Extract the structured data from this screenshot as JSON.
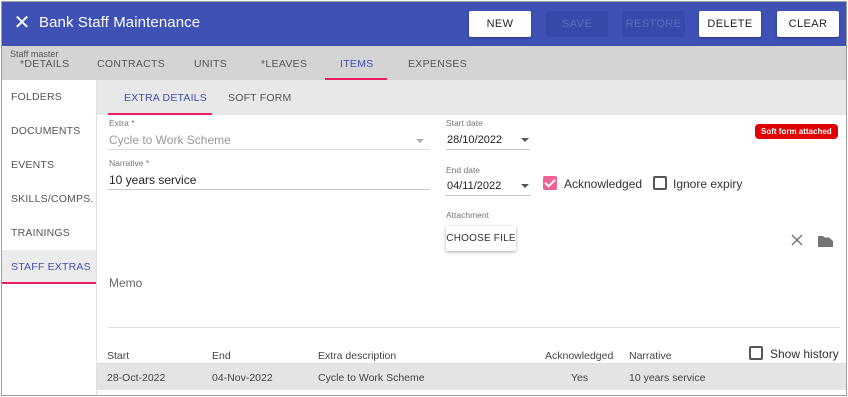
{
  "header": {
    "title": "Bank Staff Maintenance",
    "buttons": {
      "new": "NEW",
      "save": "SAVE",
      "restore": "RESTORE",
      "delete": "DELETE",
      "clear": "CLEAR"
    }
  },
  "tabs": {
    "caption": "Staff master",
    "items": [
      "*DETAILS",
      "CONTRACTS",
      "UNITS",
      "*LEAVES",
      "ITEMS",
      "EXPENSES"
    ],
    "active": "ITEMS"
  },
  "sidebar": {
    "items": [
      "FOLDERS",
      "DOCUMENTS",
      "EVENTS",
      "SKILLS/COMPS.",
      "TRAININGS",
      "STAFF EXTRAS"
    ],
    "active": "STAFF EXTRAS"
  },
  "subtabs": {
    "items": [
      "EXTRA DETAILS",
      "SOFT FORM"
    ],
    "active": "EXTRA DETAILS"
  },
  "form": {
    "extra": {
      "label": "Extra *",
      "value": "Cycle to Work Scheme"
    },
    "narrative": {
      "label": "Narrative *",
      "value": "10 years service"
    },
    "start_date": {
      "label": "Start date",
      "value": "28/10/2022"
    },
    "end_date": {
      "label": "End date",
      "value": "04/11/2022"
    },
    "acknowledged": {
      "label": "Acknowledged",
      "checked": true
    },
    "ignore_expiry": {
      "label": "Ignore expiry",
      "checked": false
    },
    "attachment": {
      "label": "Attachment",
      "button": "CHOOSE FILE"
    },
    "memo": {
      "label": "Memo"
    },
    "badge": "Soft form attached"
  },
  "history": {
    "show_history": {
      "label": "Show history",
      "checked": false
    },
    "columns": [
      "Start",
      "End",
      "Extra description",
      "Acknowledged",
      "Narrative"
    ],
    "rows": [
      [
        "28-Oct-2022",
        "04-Nov-2022",
        "Cycle to Work Scheme",
        "Yes",
        "10 years service"
      ]
    ]
  },
  "colors": {
    "primary": "#3f51b5",
    "accent": "#e91e63",
    "checkbox": "#f06292",
    "badge": "#e00000"
  },
  "icons": [
    "close-icon",
    "clear-attachment-icon",
    "folder-icon",
    "dropdown-caret-icon",
    "checkbox-icon"
  ]
}
